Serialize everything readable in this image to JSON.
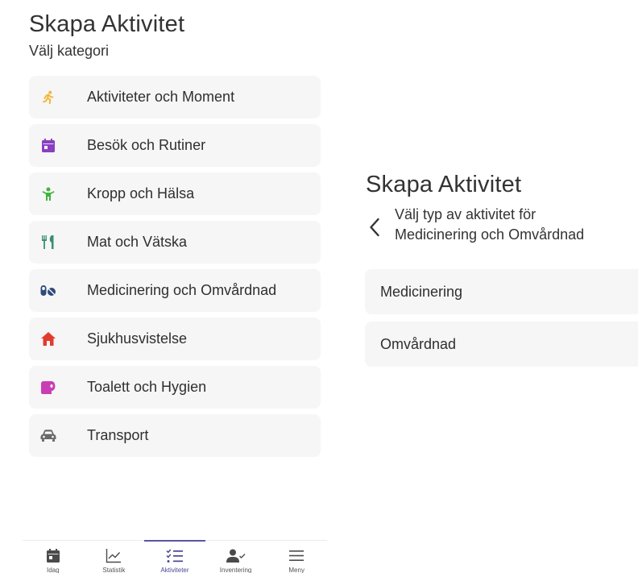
{
  "left_screen": {
    "title": "Skapa Aktivitet",
    "subtitle": "Välj kategori",
    "categories": [
      {
        "label": "Aktiviteter och Moment",
        "icon": "running-person-icon",
        "color": "#f2b73a"
      },
      {
        "label": "Besök och Rutiner",
        "icon": "calendar-icon",
        "color": "#8a3fc0"
      },
      {
        "label": "Kropp och Hälsa",
        "icon": "child-person-icon",
        "color": "#3fb43f"
      },
      {
        "label": "Mat och Vätska",
        "icon": "fork-knife-icon",
        "color": "#3a8f6c"
      },
      {
        "label": "Medicinering och Omvårdnad",
        "icon": "pills-icon",
        "color": "#2e4a7a"
      },
      {
        "label": "Sjukhusvistelse",
        "icon": "home-icon",
        "color": "#e23b2e"
      },
      {
        "label": "Toalett och Hygien",
        "icon": "toilet-paper-icon",
        "color": "#c83fb5"
      },
      {
        "label": "Transport",
        "icon": "car-icon",
        "color": "#6a6a6a"
      }
    ],
    "bottom_nav": [
      {
        "label": "Idag",
        "icon": "calendar-icon",
        "active": false
      },
      {
        "label": "Statistik",
        "icon": "chart-icon",
        "active": false
      },
      {
        "label": "Aktiviteter",
        "icon": "checklist-icon",
        "active": true
      },
      {
        "label": "Inventering",
        "icon": "person-check-icon",
        "active": false
      },
      {
        "label": "Meny",
        "icon": "menu-icon",
        "active": false
      }
    ]
  },
  "right_screen": {
    "title": "Skapa Aktivitet",
    "subtitle_line1": "Välj typ av aktivitet för",
    "subtitle_line2": "Medicinering och Omvårdnad",
    "types": [
      {
        "label": "Medicinering"
      },
      {
        "label": "Omvårdnad"
      }
    ]
  },
  "colors": {
    "accent": "#5a55a6",
    "item_background": "#f6f6f6"
  }
}
